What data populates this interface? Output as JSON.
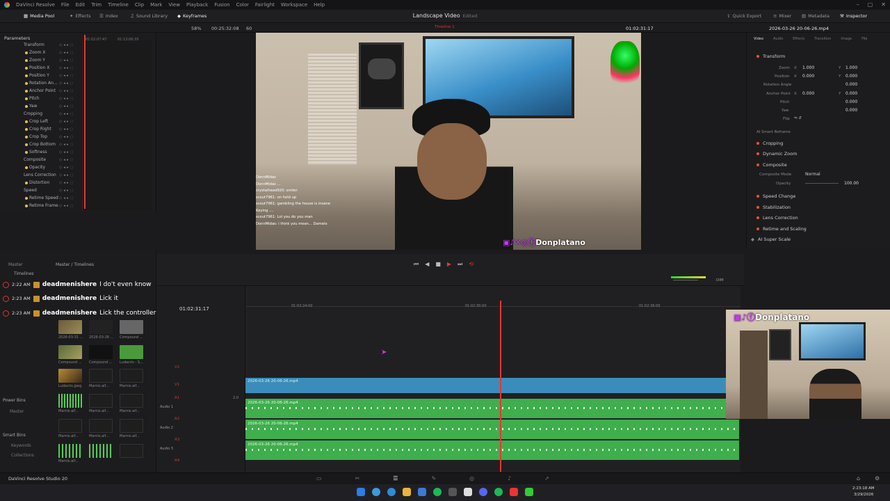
{
  "menubar": {
    "items": [
      "DaVinci Resolve",
      "File",
      "Edit",
      "Trim",
      "Timeline",
      "Clip",
      "Mark",
      "View",
      "Playback",
      "Fusion",
      "Color",
      "Fairlight",
      "Workspace",
      "Help"
    ]
  },
  "toolbar": {
    "left": [
      "Media Pool",
      "Effects",
      "Index",
      "Sound Library",
      "Keyframes"
    ],
    "right": [
      "Quick Export",
      "Mixer",
      "Metadata",
      "Inspector"
    ]
  },
  "project": {
    "title": "Landscape Video",
    "status": "Edited"
  },
  "viewer_bar": {
    "zoom": "58%",
    "timecode_left": "00:25:32:08",
    "fps": "60",
    "timecode_right": "01:02:31:17",
    "timeline_name": "Timeline 1"
  },
  "inspector": {
    "clip_name": "2026-03-26 20-06-26.mp4",
    "tabs": [
      "Video",
      "Audio",
      "Effects",
      "Transition",
      "Image",
      "File"
    ],
    "transform": {
      "title": "Transform",
      "zoom_label": "Zoom",
      "zoom_x": "1.000",
      "zoom_y": "1.000",
      "position_label": "Position",
      "position_x": "0.000",
      "position_y": "0.000",
      "rotation_label": "Rotation Angle",
      "rotation": "0.000",
      "anchor_label": "Anchor Point",
      "anchor_x": "0.000",
      "anchor_y": "0.000",
      "pitch_label": "Pitch",
      "pitch": "0.000",
      "yaw_label": "Yaw",
      "yaw": "0.000",
      "flip_label": "Flip"
    },
    "sections": [
      "AI Smart Reframe",
      "Cropping",
      "Dynamic Zoom",
      "Composite",
      "Speed Change",
      "Stabilization",
      "Lens Correction",
      "Retime and Scaling",
      "AI Super Scale"
    ],
    "composite": {
      "mode_label": "Composite Mode",
      "mode": "Normal",
      "opacity_label": "Opacity",
      "opacity": "100.00"
    }
  },
  "parameters": {
    "title": "Parameters",
    "times": [
      "01:02:07:47",
      "01:13:06:35"
    ],
    "rows": [
      "Transform",
      "Zoom X",
      "Zoom Y",
      "Position X",
      "Position Y",
      "Rotation An...",
      "Anchor Point",
      "Pitch",
      "Yaw",
      "Cropping",
      "Crop Left",
      "Crop Right",
      "Crop Top",
      "Crop Bottom",
      "Softness",
      "Composite",
      "Opacity",
      "Lens Correction",
      "Distortion",
      "Speed",
      "Retime Speed",
      "Retime Frame"
    ]
  },
  "mediapool": {
    "master": "Master",
    "path": "Master / Timelines",
    "bins": [
      "Timelines"
    ],
    "power_bins": "Power Bins",
    "power_master": "Master",
    "smart_bins": "Smart Bins",
    "keywords": "Keywords",
    "collections": "Collections",
    "labels": [
      "2026-03-31 ...",
      "2026-03-26 ...",
      "Compound ...",
      "Compound ...",
      "Compound ...",
      "Ludacris - S...",
      "Ludacris.jpeg",
      "Marnis.aif...",
      "Marnis.aif...",
      "Marnis.aif...",
      "Marnis.aif...",
      "Marnis.aif...",
      "Marnis.aif...",
      "Marnis.aif...",
      "Marnis.aif...",
      "Marnis.aif..."
    ]
  },
  "timeline": {
    "timecode": "01:02:31:17",
    "ruler": [
      "01:02:24:00",
      "01:02:30:00",
      "01:02:36:00"
    ],
    "tracks": {
      "V2": "V2",
      "V1": "V1",
      "A1": "A1",
      "A2": "A2",
      "A3": "A3",
      "A4": "A4",
      "audio1": "Audio 1",
      "audio2": "Audio 2",
      "audio3": "Audio 3",
      "level": "2.0"
    },
    "clips": {
      "video": "2026-03-26 20-06-26.mp4",
      "a1": "2026-03-26 20-06-26.mp4",
      "a2": "2026-03-26 20-06-26.mp4",
      "a3": "2026-03-26 20-06-26.mp4"
    },
    "dim": "DIM"
  },
  "comments": [
    {
      "time": "2:22 AM",
      "user": "deadmenishere",
      "msg": "I do't even know"
    },
    {
      "time": "2:23 AM",
      "user": "deadmenishere",
      "msg": "Lick it"
    },
    {
      "time": "2:23 AM",
      "user": "deadmenishere",
      "msg": "Lick the controller"
    }
  ],
  "overlay": {
    "brand": "Donplatano",
    "chat": [
      "DonnMidas",
      "DonnMidas ...",
      "crystalhead920: smiler",
      "scout7961: on hold up",
      "scout7961: gambling the house is insane",
      "Keying ....",
      "scout7961: Lol you do you man",
      "DonnMidas: i think you mean... Dameio"
    ]
  },
  "webcam": {
    "brand": "Donplatano"
  },
  "footer": {
    "app": "DaVinci Resolve Studio 20"
  },
  "taskbar": {
    "time": "2:23:18 AM",
    "date": "3/29/2026"
  },
  "colors": {
    "accent_red": "#e0553d",
    "video_clip": "#3a8dba",
    "audio_clip": "#3fae4d",
    "playhead": "#ee3333"
  }
}
